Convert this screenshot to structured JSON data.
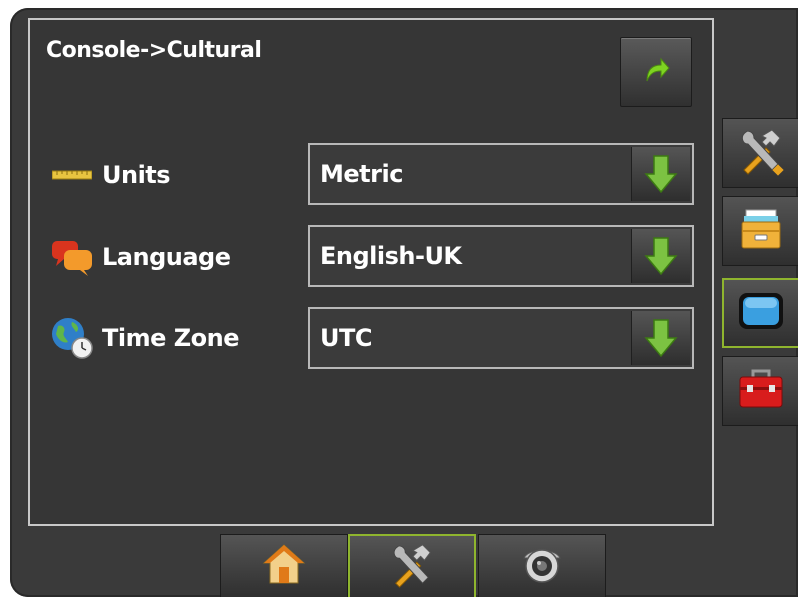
{
  "header": {
    "breadcrumb": "Console->Cultural"
  },
  "settings": [
    {
      "label": "Units",
      "icon": "ruler-icon",
      "value": "Metric"
    },
    {
      "label": "Language",
      "icon": "speech-bubbles-icon",
      "value": "English-UK"
    },
    {
      "label": "Time Zone",
      "icon": "globe-clock-icon",
      "value": "UTC"
    }
  ],
  "side_tabs": [
    {
      "icon": "tools-icon",
      "active": false
    },
    {
      "icon": "file-drawer-icon",
      "active": false
    },
    {
      "icon": "display-icon",
      "active": true
    },
    {
      "icon": "toolbox-icon",
      "active": false
    }
  ],
  "bottom_tabs": [
    {
      "icon": "home-icon",
      "active": false
    },
    {
      "icon": "tools-icon",
      "active": true
    },
    {
      "icon": "camera-icon",
      "active": false
    }
  ],
  "colors": {
    "accent_green": "#8fb52e",
    "background": "#363636",
    "text": "#ffffff"
  }
}
